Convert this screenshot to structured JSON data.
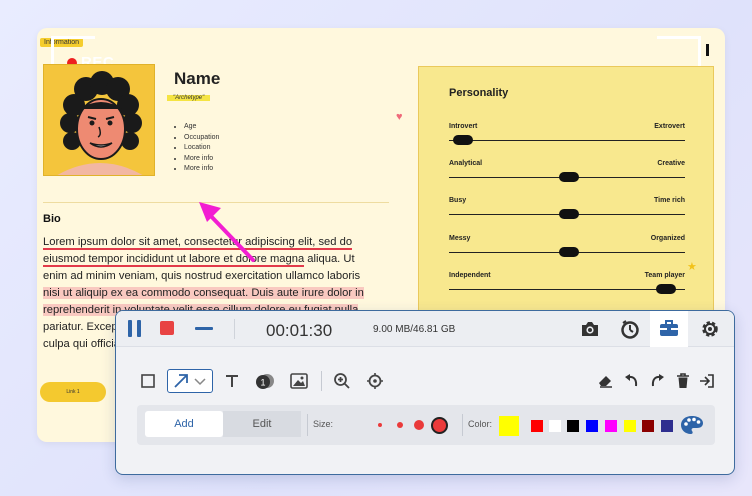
{
  "background_doc": {
    "info_tag": "Information",
    "rec_label": "REC",
    "name_title": "Name",
    "archetype": "\"Archetype\"",
    "facts": [
      "Age",
      "Occupation",
      "Location",
      "More info",
      "More info"
    ],
    "bio_title": "Bio",
    "bio": {
      "line1": "Lorem ipsum dolor sit amet, consectetur adipiscing elit, sed do",
      "line2a": "eiusmod tempor incididunt ut labore et dolore magna",
      "line2b": " aliqua. Ut",
      "line3": "enim ad minim veniam, quis nostrud exercitation ullamco laboris",
      "line4": "nisi ut aliquip ex ea commodo consequat. Duis aute irure dolor in",
      "line5": "reprehenderit in voluptate velit esse cillum dolore eu fugiat nulla",
      "line6": "pariatur. Excepteur sint occaecat cupidatat non proident, sunt in",
      "line7": "culpa qui officia deserunt mollit anim id est laborum."
    },
    "link_button": "Link 1",
    "personality": {
      "title": "Personality",
      "traits": [
        {
          "left": "Introvert",
          "right": "Extrovert",
          "value": 0.06
        },
        {
          "left": "Analytical",
          "right": "Creative",
          "value": 0.51
        },
        {
          "left": "Busy",
          "right": "Time rich",
          "value": 0.51
        },
        {
          "left": "Messy",
          "right": "Organized",
          "value": 0.51
        },
        {
          "left": "Independent",
          "right": "Team player",
          "value": 0.92
        }
      ]
    }
  },
  "toolbar": {
    "timer": "00:01:30",
    "storage": "9.00 MB/46.81 GB",
    "top_icons": [
      "camera-icon",
      "timer-icon",
      "briefcase-icon",
      "gear-icon"
    ],
    "tools": [
      "rectangle-icon",
      "arrow-icon",
      "text-icon",
      "number-step-icon",
      "image-icon",
      "zoom-in-icon",
      "spotlight-icon"
    ],
    "right_tools": [
      "eraser-icon",
      "undo-icon",
      "redo-icon",
      "trash-icon",
      "exit-icon"
    ],
    "add_label": "Add",
    "edit_label": "Edit",
    "size_label": "Size:",
    "color_label": "Color:",
    "selected_color": "#ffff00",
    "colors": [
      "#ff0000",
      "#ffffff",
      "#000000",
      "#0000ff",
      "#ff00ff",
      "#ffff00",
      "#8b0000",
      "#2e2e8f"
    ],
    "accent": "#2e64a8"
  }
}
